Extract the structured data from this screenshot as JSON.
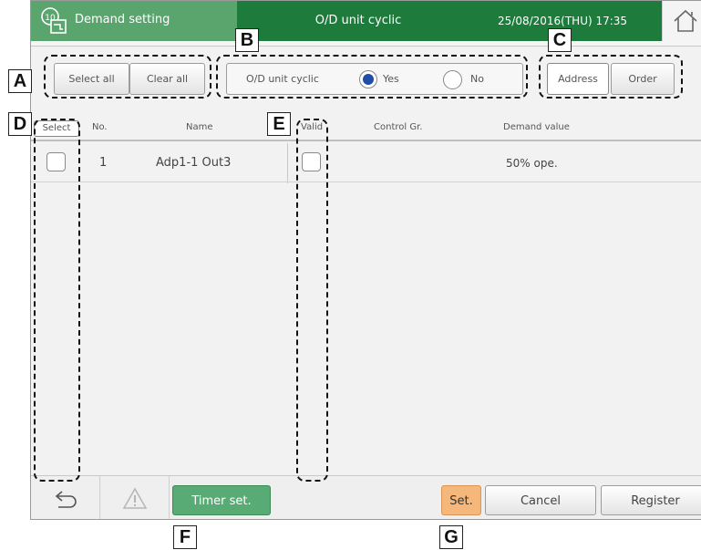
{
  "header": {
    "title": "Demand setting",
    "tab": "O/D unit cyclic",
    "datetime": "25/08/2016(THU) 17:35"
  },
  "toolbar": {
    "select_all": "Select all",
    "clear_all": "Clear all",
    "od_cyclic_label": "O/D unit cyclic",
    "yes": "Yes",
    "no": "No",
    "od_cyclic_selected": "Yes",
    "address": "Address",
    "order": "Order",
    "sort_selected": "Address"
  },
  "table": {
    "headers": {
      "select": "Select",
      "no": "No.",
      "name": "Name",
      "valid": "Valid",
      "control_gr": "Control Gr.",
      "demand_value": "Demand value"
    },
    "rows": [
      {
        "no": "1",
        "name": "Adp1-1 Out3",
        "control_gr": "",
        "demand_value": "50% ope.",
        "select": false,
        "valid": false
      }
    ]
  },
  "footer": {
    "timer_set": "Timer set.",
    "set": "Set.",
    "cancel": "Cancel",
    "register": "Register"
  },
  "callouts": {
    "a": "A",
    "b": "B",
    "c": "C",
    "d": "D",
    "e": "E",
    "f": "F",
    "g": "G"
  },
  "colors": {
    "header_green": "#1d7b3c",
    "header_light_green": "#5aa56d",
    "timer_button": "#58ab74",
    "set_button": "#f6b77b"
  }
}
